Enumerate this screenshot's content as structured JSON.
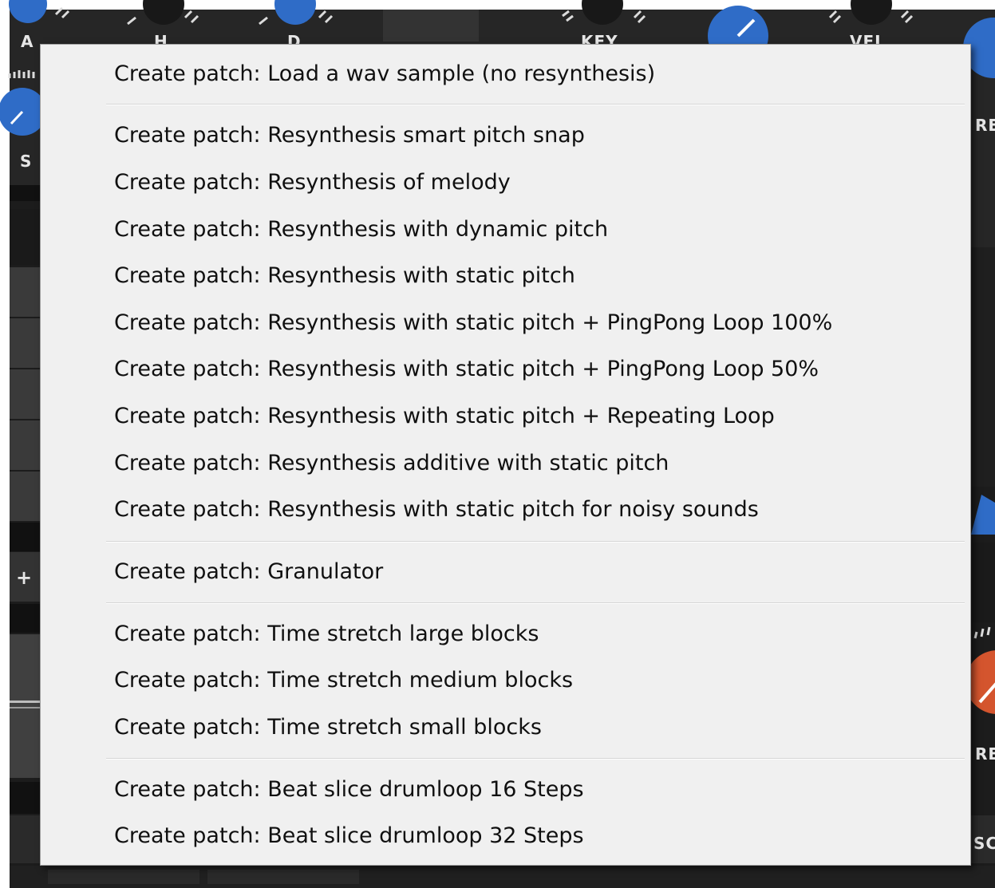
{
  "background": {
    "knob_labels": [
      "A",
      "H",
      "D",
      "KEY",
      "VEL",
      "S",
      "+",
      "RE",
      "RE",
      "SC"
    ],
    "colors": {
      "panel": "#1c1c1c",
      "knob_blue": "#2f6cc7",
      "knob_orange": "#d4552e",
      "label": "#e6e6e6"
    }
  },
  "menu": {
    "items": [
      {
        "label": "Create patch: Load a wav sample (no resynthesis)"
      },
      {
        "label": "Create patch: Resynthesis smart pitch snap"
      },
      {
        "label": "Create patch: Resynthesis of melody"
      },
      {
        "label": "Create patch: Resynthesis with dynamic pitch"
      },
      {
        "label": "Create patch: Resynthesis with static pitch"
      },
      {
        "label": "Create patch: Resynthesis with static pitch + PingPong Loop 100%"
      },
      {
        "label": "Create patch: Resynthesis with static pitch + PingPong Loop 50%"
      },
      {
        "label": "Create patch: Resynthesis with static pitch + Repeating Loop"
      },
      {
        "label": "Create patch: Resynthesis additive with static pitch"
      },
      {
        "label": "Create patch: Resynthesis with static pitch for noisy sounds"
      },
      {
        "label": "Create patch: Granulator"
      },
      {
        "label": "Create patch: Time stretch large blocks"
      },
      {
        "label": "Create patch: Time stretch medium blocks"
      },
      {
        "label": "Create patch: Time stretch small blocks"
      },
      {
        "label": "Create patch: Beat slice drumloop 16 Steps"
      },
      {
        "label": "Create patch: Beat slice drumloop 32 Steps"
      }
    ]
  }
}
